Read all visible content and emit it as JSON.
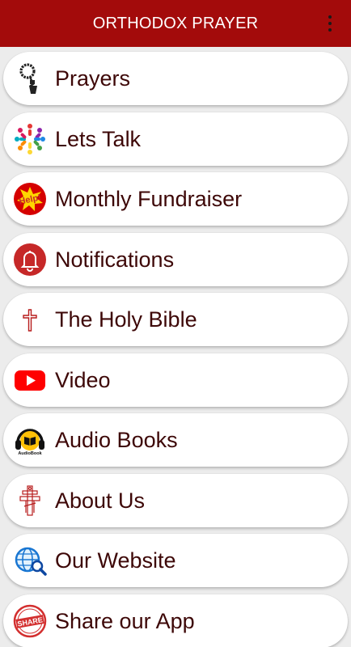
{
  "app": {
    "title": "ORTHODOX PRAYER",
    "overflow_icon": "more-vertical-icon"
  },
  "colors": {
    "appbar": "#a30b0b",
    "label": "#3d0707",
    "card": "#ffffff",
    "background": "#ececec"
  },
  "menu": {
    "items": [
      {
        "label": "Prayers",
        "icon": "prayer-rope-icon"
      },
      {
        "label": "Lets Talk",
        "icon": "people-circle-icon"
      },
      {
        "label": "Monthly Fundraiser",
        "icon": "help-badge-icon",
        "icon_text": "Help!"
      },
      {
        "label": "Notifications",
        "icon": "bell-icon"
      },
      {
        "label": "The Holy Bible",
        "icon": "cross-icon"
      },
      {
        "label": "Video",
        "icon": "play-video-icon"
      },
      {
        "label": "Audio Books",
        "icon": "headphones-book-icon",
        "icon_text": "AudioBook"
      },
      {
        "label": "About Us",
        "icon": "orthodox-cross-icon"
      },
      {
        "label": "Our Website",
        "icon": "globe-search-icon"
      },
      {
        "label": "Share our App",
        "icon": "share-stamp-icon",
        "icon_text": "SHARE"
      }
    ]
  }
}
